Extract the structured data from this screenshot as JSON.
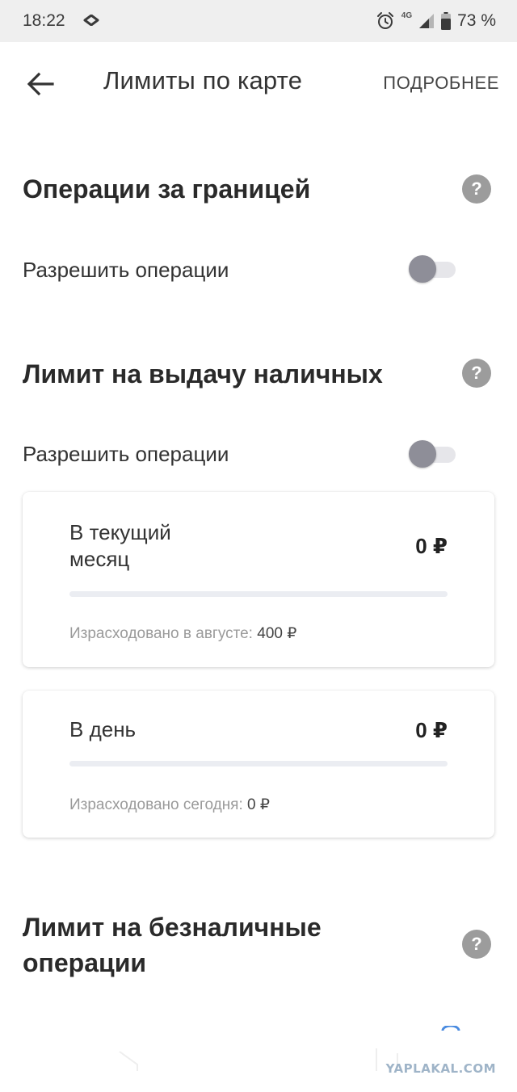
{
  "status_bar": {
    "time": "18:22",
    "network": "4G",
    "battery": "73 %"
  },
  "app_bar": {
    "title": "Лимиты по карте",
    "more_label": "ПОДРОБНЕЕ"
  },
  "sections": {
    "abroad": {
      "title": "Операции за границей",
      "allow_label": "Разрешить операции",
      "enabled": false
    },
    "cash": {
      "title": "Лимит на выдачу наличных",
      "allow_label": "Разрешить операции",
      "enabled": false,
      "cards": [
        {
          "label_line1": "В текущий",
          "label_line2": "месяц",
          "value": "0 ₽",
          "note_prefix": "Израсходовано в августе: ",
          "note_amount": "400 ₽"
        },
        {
          "label_line1": "В день",
          "value": "0 ₽",
          "note_prefix": "Израсходовано сегодня: ",
          "note_amount": "0 ₽"
        }
      ]
    },
    "cashless": {
      "title_line1": "Лимит на безналичные",
      "title_line2": "операции"
    }
  },
  "watermark": "YAPLAKAL.COM",
  "colors": {
    "help_icon": "#9c9c9c",
    "toggle_thumb": "#8e8e98",
    "toggle_track": "#e6e6ea",
    "bar_track": "#ebedf2"
  }
}
